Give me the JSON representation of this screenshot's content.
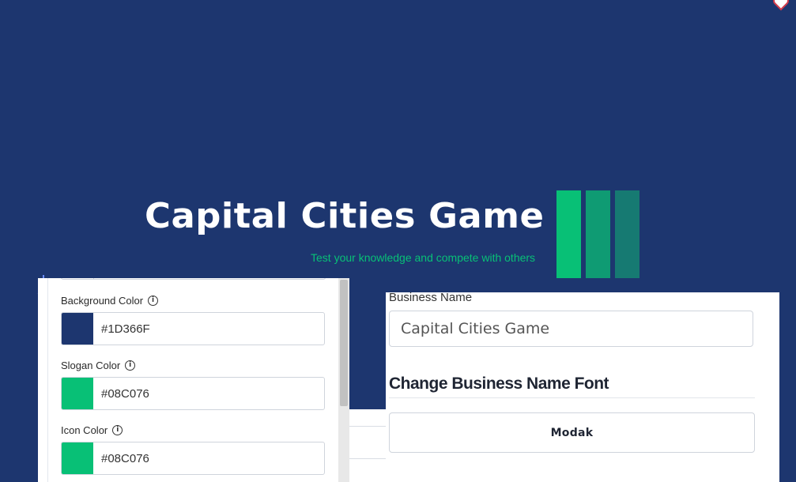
{
  "colors": {
    "background": "#1D366F",
    "slogan": "#08C076",
    "icon_bars": [
      "#08C076",
      "#0F9B73",
      "#167A72"
    ]
  },
  "logo": {
    "title": "Capital Cities Game",
    "slogan": "Test your knowledge and compete with others",
    "icon": "three-vertical-bars-icon"
  },
  "left_panel": {
    "fields": [
      {
        "label": "Background Color",
        "value": "#1D366F",
        "swatch": "#1D366F"
      },
      {
        "label": "Slogan Color",
        "value": "#08C076",
        "swatch": "#08C076"
      },
      {
        "label": "Icon Color",
        "value": "#08C076",
        "swatch": "#08C076"
      }
    ]
  },
  "right_panel": {
    "business_name_label": "Business Name",
    "business_name_value": "Capital Cities Game",
    "font_heading": "Change Business Name Font",
    "font_button_label": "Modak"
  }
}
